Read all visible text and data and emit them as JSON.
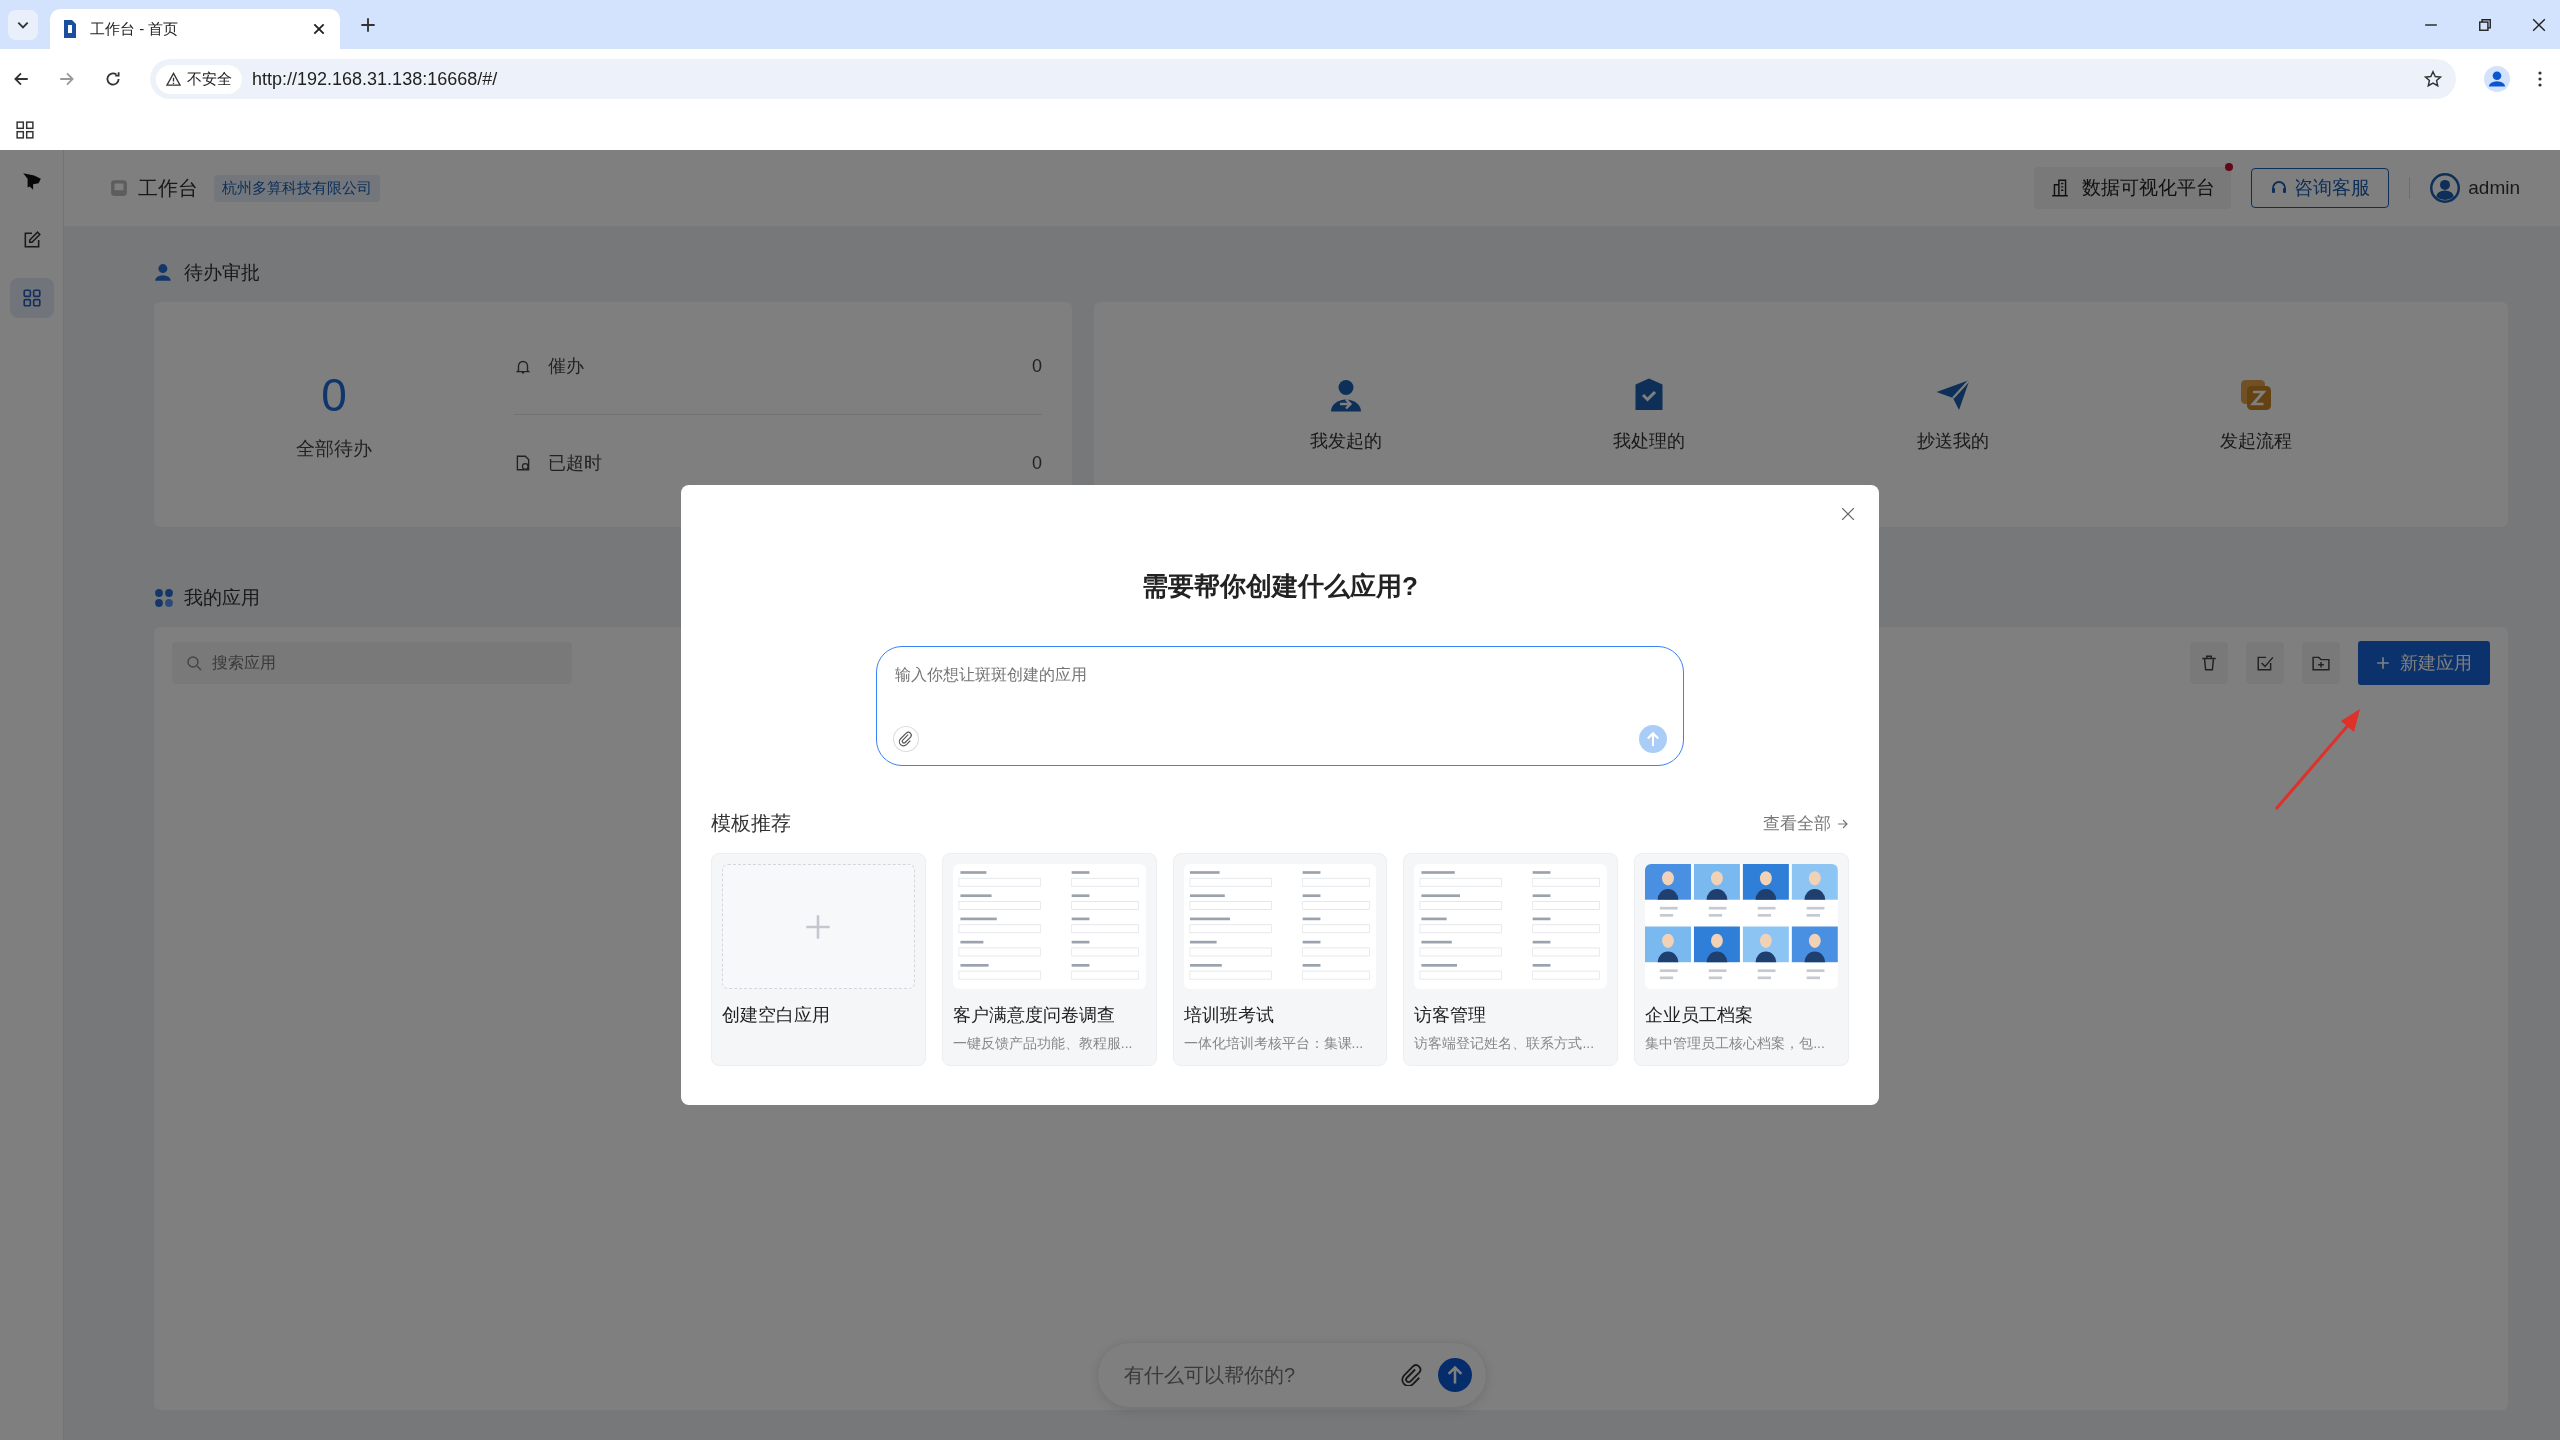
{
  "browser": {
    "tab_title": "工作台 - 首页",
    "security": "不安全",
    "url": "http://192.168.31.138:16668/#/"
  },
  "sidebar": {
    "items": [
      {
        "kind": "edit",
        "selected": false
      },
      {
        "kind": "apps",
        "selected": true
      }
    ]
  },
  "header": {
    "title": "工作台",
    "company": "杭州多算科技有限公司",
    "platform_button": "数据可视化平台",
    "platform_notification": true,
    "support_button": "咨询客服",
    "user": "admin"
  },
  "approvals": {
    "title": "待办审批",
    "total": "0",
    "total_label": "全部待办",
    "stats": [
      {
        "kind": "urge",
        "label": "催办",
        "value": "0"
      },
      {
        "kind": "overdue",
        "label": "已超时",
        "value": "0"
      }
    ],
    "shortcuts": [
      {
        "kind": "initiated",
        "label": "我发起的"
      },
      {
        "kind": "handled",
        "label": "我处理的"
      },
      {
        "kind": "cc",
        "label": "抄送我的"
      },
      {
        "kind": "start",
        "label": "发起流程"
      }
    ]
  },
  "apps": {
    "title": "我的应用",
    "search_placeholder": "搜索应用",
    "new_button": "新建应用"
  },
  "chat": {
    "placeholder": "有什么可以帮你的?"
  },
  "dialog": {
    "title": "需要帮你创建什么应用?",
    "prompt_placeholder": "输入你想让斑斑创建的应用",
    "templates_title": "模板推荐",
    "view_all": "查看全部",
    "templates": [
      {
        "kind": "blank",
        "name": "创建空白应用"
      },
      {
        "kind": "form",
        "name": "客户满意度问卷调查",
        "description": "一键反馈产品功能、教程服..."
      },
      {
        "kind": "form",
        "name": "培训班考试",
        "description": "一体化培训考核平台：集课..."
      },
      {
        "kind": "form",
        "name": "访客管理",
        "description": "访客端登记姓名、联系方式..."
      },
      {
        "kind": "people",
        "name": "企业员工档案",
        "description": "集中管理员工核心档案，包..."
      }
    ]
  }
}
